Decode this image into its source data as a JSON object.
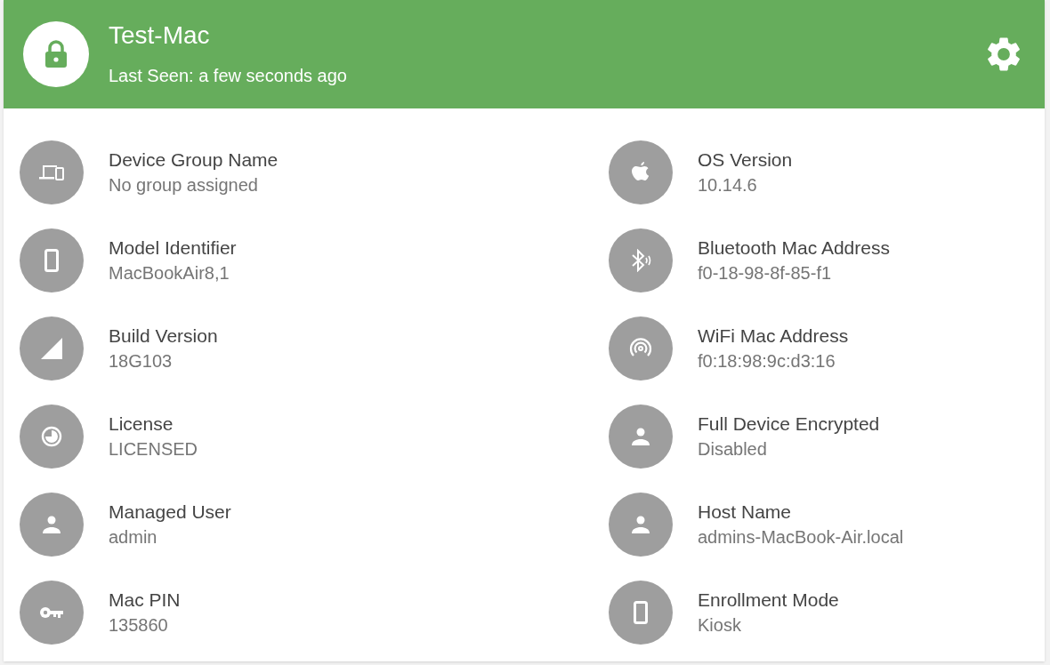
{
  "header": {
    "title": "Test-Mac",
    "subtitle": "Last Seen: a few seconds ago"
  },
  "left_column": [
    {
      "label": "Device Group Name",
      "value": "No group assigned"
    },
    {
      "label": "Model Identifier",
      "value": "MacBookAir8,1"
    },
    {
      "label": "Build Version",
      "value": "18G103"
    },
    {
      "label": "License",
      "value": "LICENSED"
    },
    {
      "label": "Managed User",
      "value": "admin"
    },
    {
      "label": "Mac PIN",
      "value": "135860"
    }
  ],
  "right_column": [
    {
      "label": "OS Version",
      "value": "10.14.6"
    },
    {
      "label": "Bluetooth Mac Address",
      "value": "f0-18-98-8f-85-f1"
    },
    {
      "label": "WiFi Mac Address",
      "value": "f0:18:98:9c:d3:16"
    },
    {
      "label": "Full Device Encrypted",
      "value": "Disabled"
    },
    {
      "label": "Host Name",
      "value": "admins-MacBook-Air.local"
    },
    {
      "label": "Enrollment Mode",
      "value": "Kiosk"
    }
  ]
}
